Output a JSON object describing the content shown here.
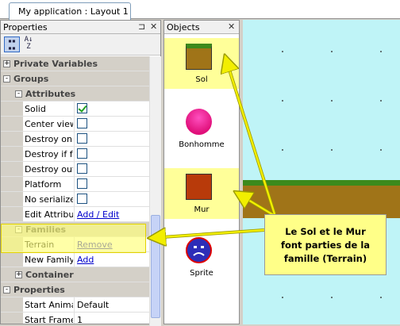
{
  "document_tab": {
    "label": "My application : Layout 1"
  },
  "properties_panel": {
    "title": "Properties",
    "pin_icon": "pin-icon",
    "close_icon": "close-icon",
    "toolbar": {
      "categorized": "categorized-view-icon",
      "alphabetical": "sort-az-icon"
    },
    "rows": [
      {
        "type": "category",
        "label": "Private Variables",
        "expander": "+"
      },
      {
        "type": "category",
        "label": "Groups",
        "expander": "-"
      },
      {
        "type": "subcategory",
        "label": "Attributes",
        "expander": "-"
      },
      {
        "type": "prop",
        "name": "Solid",
        "value_type": "checkbox",
        "checked": true
      },
      {
        "type": "prop",
        "name": "Center view",
        "value_type": "checkbox",
        "checked": false
      },
      {
        "type": "prop",
        "name": "Destroy on S",
        "value_type": "checkbox",
        "checked": false
      },
      {
        "type": "prop",
        "name": "Destroy if fa",
        "value_type": "checkbox",
        "checked": false
      },
      {
        "type": "prop",
        "name": "Destroy out",
        "value_type": "checkbox",
        "checked": false
      },
      {
        "type": "prop",
        "name": "Platform",
        "value_type": "checkbox",
        "checked": false
      },
      {
        "type": "prop",
        "name": "No serialize",
        "value_type": "checkbox",
        "checked": false
      },
      {
        "type": "prop",
        "name": "Edit Attributes",
        "value_type": "link",
        "value": "Add / Edit"
      },
      {
        "type": "subcategory",
        "label": "Families",
        "expander": "-"
      },
      {
        "type": "prop",
        "name": "Terrain",
        "value_type": "link",
        "value": "Remove"
      },
      {
        "type": "prop",
        "name": "New Family",
        "value_type": "link",
        "value": "Add"
      },
      {
        "type": "subcategory",
        "label": "Container",
        "expander": "+"
      },
      {
        "type": "category",
        "label": "Properties",
        "expander": "-"
      },
      {
        "type": "prop",
        "name": "Start Animation",
        "value_type": "text",
        "value": "Default"
      },
      {
        "type": "prop",
        "name": "Start Frame",
        "value_type": "text",
        "value": "1"
      }
    ]
  },
  "objects_panel": {
    "title": "Objects",
    "close_icon": "close-icon",
    "items": [
      {
        "label": "Sol",
        "icon": "sol-icon",
        "selected": true
      },
      {
        "label": "Bonhomme",
        "icon": "bonhomme-icon",
        "selected": false
      },
      {
        "label": "Mur",
        "icon": "mur-icon",
        "selected": true
      },
      {
        "label": "Sprite",
        "icon": "sprite-icon",
        "selected": false
      }
    ]
  },
  "callout": {
    "lines": [
      "Le Sol et le Mur",
      "font parties de la",
      "famille (Terrain)"
    ]
  },
  "colors": {
    "highlight": "#ffff80",
    "callout_bg": "#ffff88",
    "canvas_bg": "#bff4f7",
    "grass": "#3c8a1c",
    "dirt": "#a07418"
  }
}
